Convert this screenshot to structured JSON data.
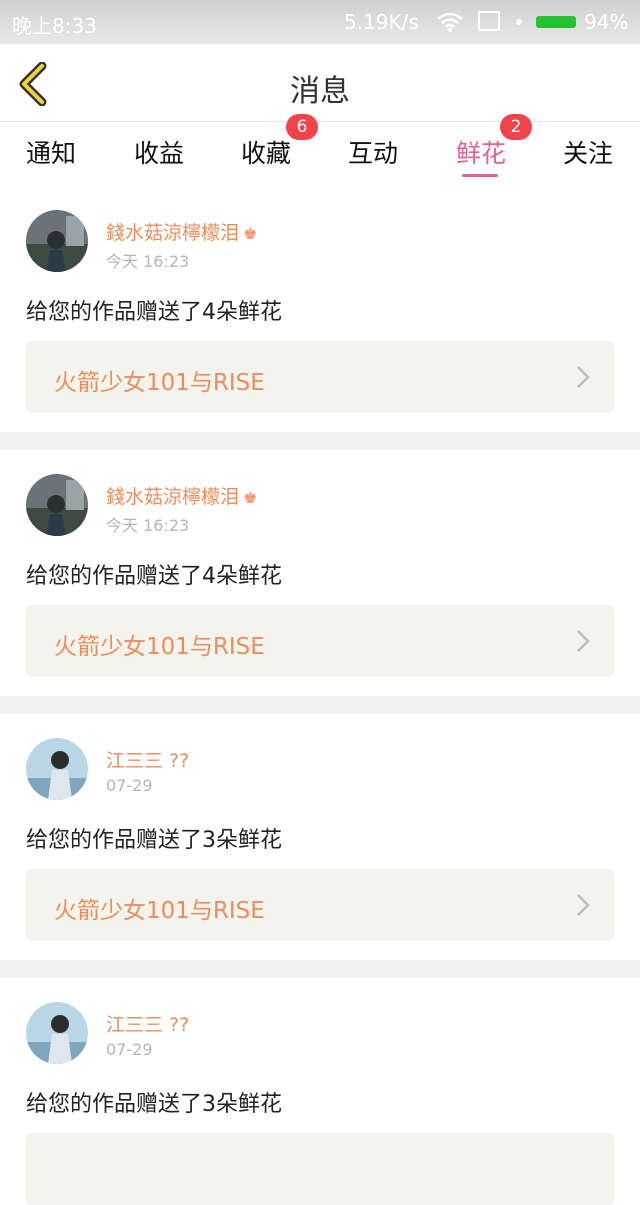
{
  "statusbar": {
    "time": "晚上8:33",
    "net": "5.19K/s",
    "battery": "94%"
  },
  "header": {
    "title": "消息"
  },
  "tabs": [
    {
      "label": "通知"
    },
    {
      "label": "收益"
    },
    {
      "label": "收藏",
      "badge": "6"
    },
    {
      "label": "互动"
    },
    {
      "label": "鲜花",
      "badge": "2",
      "active": true
    },
    {
      "label": "关注"
    }
  ],
  "colors": {
    "accent": "#e2609b",
    "name": "#ef8c5b",
    "badge": "#f2424a"
  },
  "messages": [
    {
      "name": "錢水菇涼檸檬泪",
      "time": "今天 16:23",
      "text": "给您的作品赠送了4朵鲜花",
      "work": "火箭少女101与RISE",
      "crown": true
    },
    {
      "name": "錢水菇涼檸檬泪",
      "time": "今天 16:23",
      "text": "给您的作品赠送了4朵鲜花",
      "work": "火箭少女101与RISE",
      "crown": true
    },
    {
      "name": "江三三 ??",
      "time": "07-29",
      "text": "给您的作品赠送了3朵鲜花",
      "work": "火箭少女101与RISE"
    },
    {
      "name": "江三三 ??",
      "time": "07-29",
      "text": "给您的作品赠送了3朵鲜花"
    }
  ]
}
